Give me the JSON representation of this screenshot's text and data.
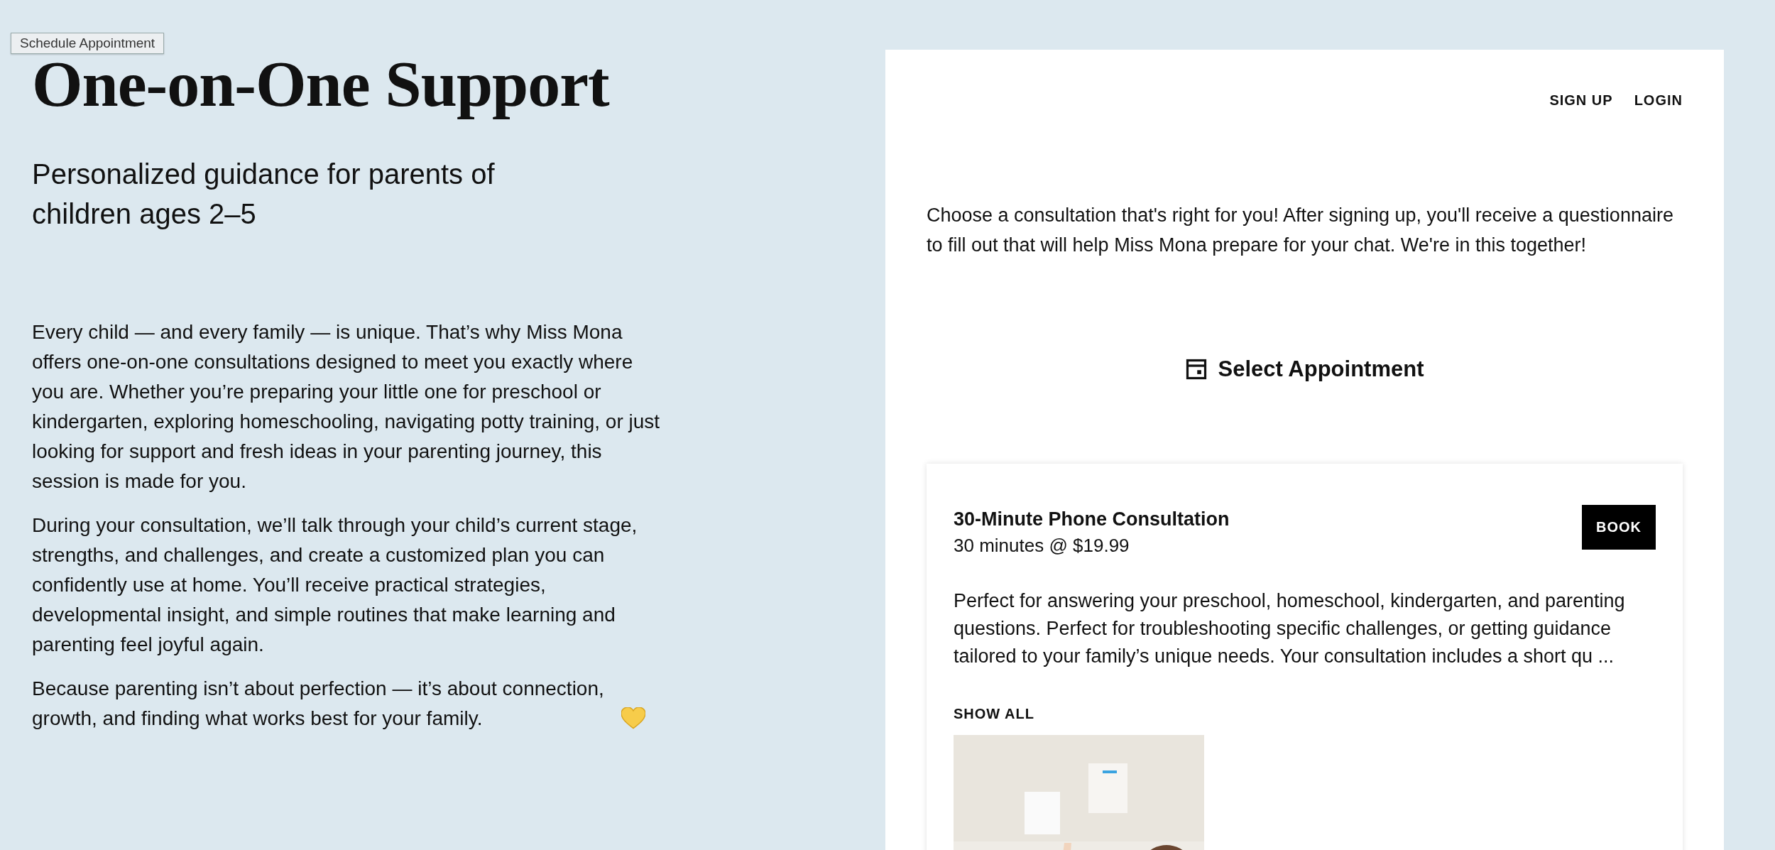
{
  "tooltip": "Schedule Appointment",
  "title": "One-on-One Support",
  "subtitle": "Personalized guidance for parents of children ages 2–5",
  "paragraphs": [
    "Every child — and every family — is unique. That’s why Miss Mona offers one-on-one consultations designed to meet you exactly where you are. Whether you’re preparing your little one for preschool or kindergarten, exploring homeschooling, navigating potty training, or just looking for support and fresh ideas in your parenting journey, this session is made for you.",
    "During your consultation, we’ll talk through your child’s current stage, strengths, and challenges, and create a customized plan you can confidently use at home. You’ll receive practical strategies, developmental insight, and simple routines that make learning and parenting feel joyful again.",
    "Because parenting isn’t about perfection — it’s about connection, growth, and finding what works best for your family."
  ],
  "nav": [
    "SIGN UP",
    "LOGIN"
  ],
  "intro": "Choose a consultation that's right for you! After signing up, you'll receive a questionnaire to fill out that will help Miss Mona prepare for your chat. We're in this together!",
  "section_title": "Select Appointment",
  "appointment": {
    "name": "30-Minute Phone Consultation",
    "duration_price": "30 minutes @ $19.99",
    "button": "BOOK",
    "description": "Perfect for answering your preschool, homeschool, kindergarten, and parenting questions. Perfect for troubleshooting specific challenges, or getting guidance tailored to your family’s unique needs. Your consultation includes a short qu ...",
    "show_all": "SHOW ALL"
  }
}
